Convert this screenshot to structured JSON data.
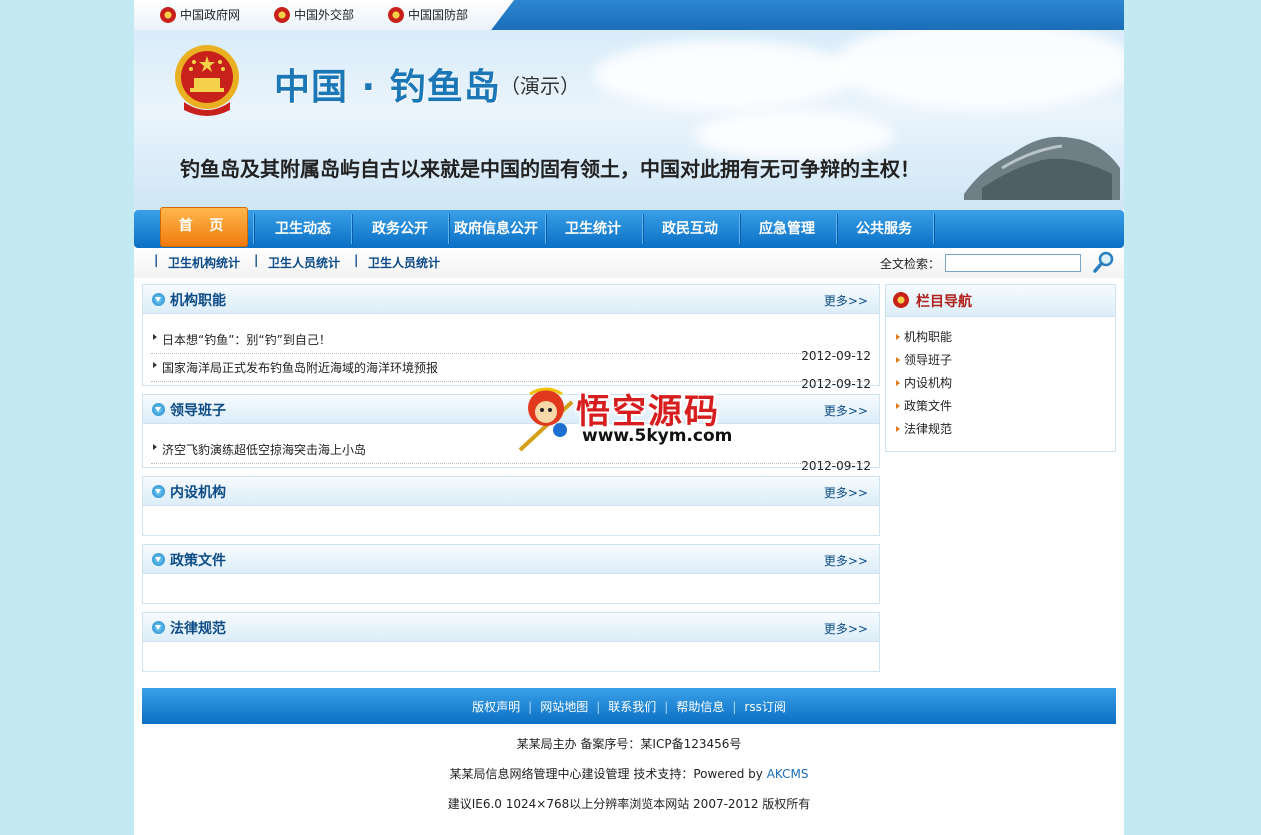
{
  "top_links": [
    "中国政府网",
    "中国外交部",
    "中国国防部"
  ],
  "banner": {
    "title": "中国 · 钓鱼岛",
    "subtitle": "（演示）",
    "slogan": "钓鱼岛及其附属岛屿自古以来就是中国的固有领土，中国对此拥有无可争辩的主权！"
  },
  "nav": {
    "home": "首 页",
    "items": [
      "卫生动态",
      "政务公开",
      "政府信息公开",
      "卫生统计",
      "政民互动",
      "应急管理",
      "公共服务"
    ]
  },
  "subnav": {
    "links": [
      "卫生机构统计",
      "卫生人员统计",
      "卫生人员统计"
    ],
    "search_label": "全文检索：",
    "search_value": ""
  },
  "sections": [
    {
      "title": "机构职能",
      "more": "更多>>",
      "items": [
        {
          "text": "日本想“钓鱼”：别“钓”到自己！",
          "date": "2012-09-12"
        },
        {
          "text": "国家海洋局正式发布钓鱼岛附近海域的海洋环境预报",
          "date": "2012-09-12"
        }
      ]
    },
    {
      "title": "领导班子",
      "more": "更多>>",
      "items": [
        {
          "text": "济空飞豹演练超低空掠海突击海上小岛",
          "date": "2012-09-12"
        }
      ]
    },
    {
      "title": "内设机构",
      "more": "更多>>",
      "items": []
    },
    {
      "title": "政策文件",
      "more": "更多>>",
      "items": []
    },
    {
      "title": "法律规范",
      "more": "更多>>",
      "items": []
    }
  ],
  "sidebar": {
    "title": "栏目导航",
    "items": [
      "机构职能",
      "领导班子",
      "内设机构",
      "政策文件",
      "法律规范"
    ]
  },
  "watermark": {
    "title": "悟空源码",
    "url": "www.5kym.com"
  },
  "footer": {
    "links": [
      "版权声明",
      "网站地图",
      "联系我们",
      "帮助信息",
      "rss订阅"
    ],
    "line1": "某某局主办 备案序号：某ICP备123456号",
    "line2_prefix": "某某局信息网络管理中心建设管理 技术支持：Powered by ",
    "line2_link": "AKCMS",
    "line3": "建议IE6.0 1024×768以上分辨率浏览本网站 2007-2012 版权所有"
  },
  "colors": {
    "brand_blue": "#1a6db8",
    "home_orange": "#f07b0c",
    "page_bg": "#c3eaf2"
  }
}
